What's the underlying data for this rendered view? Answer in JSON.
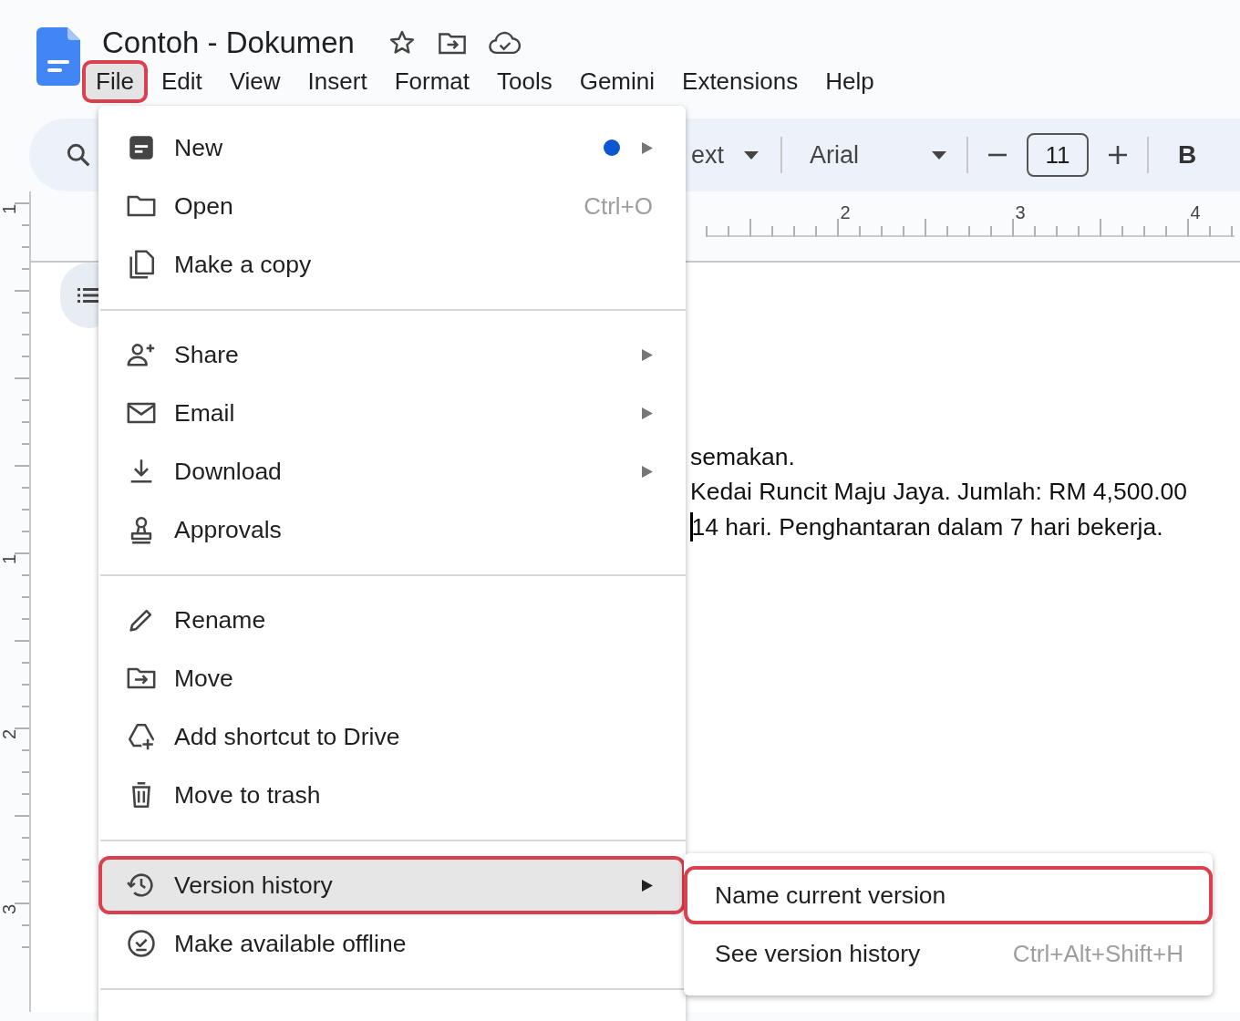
{
  "app": {
    "title": "Contoh - Dokumen"
  },
  "menubar": [
    {
      "label": "File",
      "selected": true,
      "highlighted": true
    },
    {
      "label": "Edit",
      "selected": false,
      "highlighted": false
    },
    {
      "label": "View",
      "selected": false,
      "highlighted": false
    },
    {
      "label": "Insert",
      "selected": false,
      "highlighted": false
    },
    {
      "label": "Format",
      "selected": false,
      "highlighted": false
    },
    {
      "label": "Tools",
      "selected": false,
      "highlighted": false
    },
    {
      "label": "Gemini",
      "selected": false,
      "highlighted": false
    },
    {
      "label": "Extensions",
      "selected": false,
      "highlighted": false
    },
    {
      "label": "Help",
      "selected": false,
      "highlighted": false
    }
  ],
  "toolbar": {
    "style_field": "ext",
    "font_field": "Arial",
    "font_size": "11",
    "bold_label": "B"
  },
  "ruler": {
    "labels": [
      "2",
      "3",
      "4"
    ]
  },
  "vertical_ruler": {
    "labels": [
      "1",
      "1",
      "2",
      "3"
    ]
  },
  "document": {
    "lines": [
      "semakan.",
      "Kedai Runcit Maju Jaya. Jumlah: RM 4,500.00",
      "14 hari. Penghantaran dalam 7 hari bekerja."
    ]
  },
  "file_menu": {
    "sections": [
      {
        "items": [
          {
            "label": "New",
            "submenu": true,
            "notification": true,
            "selected": false,
            "highlighted": false
          },
          {
            "label": "Open",
            "shortcut": "Ctrl+O",
            "submenu": false,
            "notification": false,
            "selected": false,
            "highlighted": false
          },
          {
            "label": "Make a copy",
            "submenu": false,
            "notification": false,
            "selected": false,
            "highlighted": false
          }
        ]
      },
      {
        "items": [
          {
            "label": "Share",
            "submenu": true,
            "notification": false,
            "selected": false,
            "highlighted": false
          },
          {
            "label": "Email",
            "submenu": true,
            "notification": false,
            "selected": false,
            "highlighted": false
          },
          {
            "label": "Download",
            "submenu": true,
            "notification": false,
            "selected": false,
            "highlighted": false
          },
          {
            "label": "Approvals",
            "submenu": false,
            "notification": false,
            "selected": false,
            "highlighted": false
          }
        ]
      },
      {
        "items": [
          {
            "label": "Rename",
            "submenu": false,
            "notification": false,
            "selected": false,
            "highlighted": false
          },
          {
            "label": "Move",
            "submenu": false,
            "notification": false,
            "selected": false,
            "highlighted": false
          },
          {
            "label": "Add shortcut to Drive",
            "submenu": false,
            "notification": false,
            "selected": false,
            "highlighted": false
          },
          {
            "label": "Move to trash",
            "submenu": false,
            "notification": false,
            "selected": false,
            "highlighted": false
          }
        ]
      },
      {
        "items": [
          {
            "label": "Version history",
            "submenu": true,
            "notification": false,
            "selected": true,
            "highlighted": true
          },
          {
            "label": "Make available offline",
            "submenu": false,
            "notification": false,
            "selected": false,
            "highlighted": false
          }
        ]
      }
    ]
  },
  "version_submenu": {
    "items": [
      {
        "label": "Name current version",
        "highlighted": true
      },
      {
        "label": "See version history",
        "shortcut": "Ctrl+Alt+Shift+H",
        "highlighted": false
      }
    ]
  }
}
